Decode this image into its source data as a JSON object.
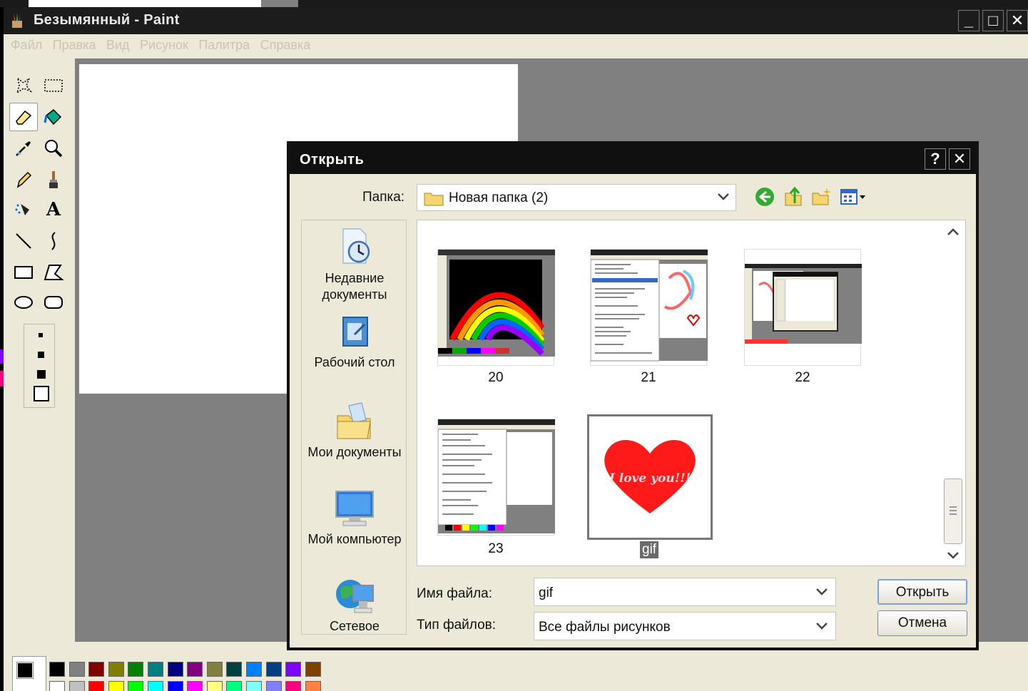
{
  "window": {
    "title": "Безымянный - Paint"
  },
  "menu": [
    "Файл",
    "Правка",
    "Вид",
    "Рисунок",
    "Палитра",
    "Справка"
  ],
  "dialog": {
    "title": "Открыть",
    "look_in_label": "Папка:",
    "look_in_value": "Новая папка (2)",
    "places": [
      {
        "label": "Недавние документы",
        "icon": "recent-documents-icon"
      },
      {
        "label": "Рабочий стол",
        "icon": "desktop-icon"
      },
      {
        "label": "Мои документы",
        "icon": "my-documents-icon"
      },
      {
        "label": "Мой компьютер",
        "icon": "my-computer-icon"
      },
      {
        "label": "Сетевое",
        "icon": "network-icon"
      }
    ],
    "files": [
      {
        "name": "20"
      },
      {
        "name": "21"
      },
      {
        "name": "22"
      },
      {
        "name": "23"
      },
      {
        "name": "gif",
        "selected": true,
        "thumb_text": "I love you!!!"
      }
    ],
    "filename_label": "Имя файла:",
    "filename_value": "gif",
    "filetype_label": "Тип файлов:",
    "filetype_value": "Все файлы рисунков",
    "open_button": "Открыть",
    "cancel_button": "Отмена"
  },
  "palette": {
    "top": [
      "#000000",
      "#808080",
      "#800000",
      "#808000",
      "#008000",
      "#008080",
      "#000080",
      "#800080",
      "#808040",
      "#004040",
      "#0080ff",
      "#004080",
      "#8000ff",
      "#804000"
    ],
    "bottom": [
      "#ffffff",
      "#c0c0c0",
      "#ff0000",
      "#ffff00",
      "#00ff00",
      "#00ffff",
      "#0000ff",
      "#ff00ff",
      "#ffff80",
      "#00ff80",
      "#80ffff",
      "#8080ff",
      "#ff0080",
      "#ff8040"
    ]
  }
}
